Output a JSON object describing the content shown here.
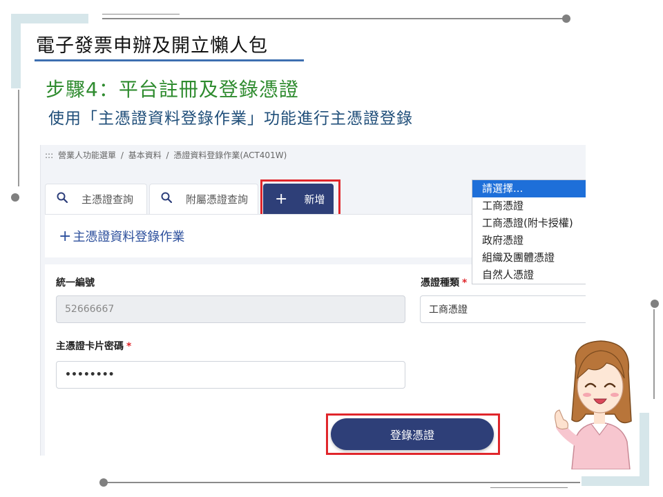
{
  "slide": {
    "title": "電子發票申辦及開立懶人包",
    "step_title": "步驟4：平台註冊及登錄憑證",
    "step_desc": "使用「主憑證資料登錄作業」功能進行主憑證登錄"
  },
  "breadcrumb": {
    "menu_glyph": ":::",
    "items": [
      "營業人功能選單",
      "基本資料",
      "憑證資料登錄作業(ACT401W)"
    ],
    "separator": "/"
  },
  "tabs": [
    {
      "icon": "search-icon",
      "glyph": "🔍",
      "label": "主憑證查詢"
    },
    {
      "icon": "search-icon",
      "glyph": "🔍",
      "label": "附屬憑證查詢"
    },
    {
      "icon": "plus-icon",
      "glyph": "+",
      "label": "新增"
    }
  ],
  "form": {
    "section_glyph": "+",
    "section_title": "主憑證資料登錄作業",
    "ban_label": "統一編號",
    "ban_value": "52666667",
    "cert_type_label": "憑證種類",
    "cert_type_value": "工商憑證",
    "card_password_label": "主憑證卡片密碼",
    "card_password_value": "••••••••",
    "required_mark": "*",
    "submit_label": "登錄憑證"
  },
  "cert_type_dropdown": {
    "options": [
      "請選擇...",
      "工商憑證",
      "工商憑證(附卡授權)",
      "政府憑證",
      "組織及團體憑證",
      "自然人憑證"
    ],
    "highlighted_index": 0
  },
  "colors": {
    "primary_navy": "#2e3f78",
    "highlight_red": "#e0262b",
    "step_green": "#2e8b2e",
    "desc_blue": "#1f4e79",
    "dropdown_selected": "#1e6fd9"
  }
}
